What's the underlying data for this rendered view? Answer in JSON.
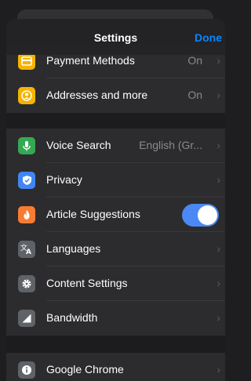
{
  "navbar": {
    "title": "Settings",
    "done_label": "Done"
  },
  "colors": {
    "accent": "#0a84ff",
    "toggle_on": "#4b88f4",
    "payment_icon": "#f4b400",
    "addresses_icon": "#f4b400",
    "voice_icon": "#34a853",
    "privacy_icon": "#4285f4",
    "article_icon": "#f57c32",
    "languages_icon": "#5f6368",
    "content_icon": "#5f6368",
    "bandwidth_icon": "#5f6368",
    "chrome_icon": "#5f6368"
  },
  "rows": {
    "payment": {
      "label": "Payment Methods",
      "value": "On",
      "icon": "card-icon"
    },
    "addresses": {
      "label": "Addresses and more",
      "value": "On",
      "icon": "person-icon"
    },
    "voice": {
      "label": "Voice Search",
      "value": "English (Gr...",
      "icon": "microphone-icon"
    },
    "privacy": {
      "label": "Privacy",
      "icon": "shield-icon"
    },
    "article": {
      "label": "Article Suggestions",
      "toggle_on": true,
      "icon": "flame-icon"
    },
    "languages": {
      "label": "Languages",
      "icon": "translate-icon"
    },
    "content": {
      "label": "Content Settings",
      "icon": "gear-icon"
    },
    "bandwidth": {
      "label": "Bandwidth",
      "icon": "signal-icon"
    },
    "chrome": {
      "label": "Google Chrome",
      "icon": "info-icon"
    }
  }
}
